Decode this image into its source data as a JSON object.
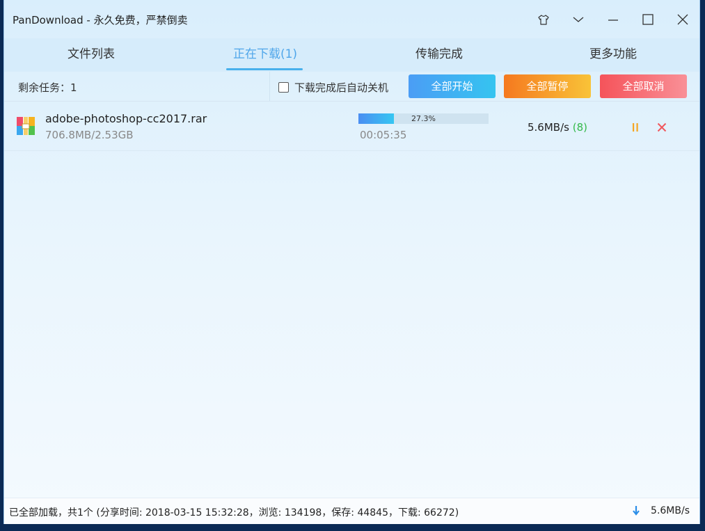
{
  "window": {
    "title": "PanDownload - 永久免费，严禁倒卖"
  },
  "titlebar_icons": [
    "shirt-icon",
    "chevron-down-icon",
    "minimize-icon",
    "maximize-icon",
    "close-icon"
  ],
  "tabs": [
    {
      "label": "文件列表"
    },
    {
      "label": "正在下载(1)",
      "active": true
    },
    {
      "label": "传输完成"
    },
    {
      "label": "更多功能"
    }
  ],
  "toolbar": {
    "remaining": "剩余任务：1",
    "auto_shutdown": {
      "label": "下载完成后自动关机",
      "checked": false
    },
    "start_all": "全部开始",
    "pause_all": "全部暂停",
    "cancel_all": "全部取消"
  },
  "downloads": [
    {
      "name": "adobe-photoshop-cc2017.rar",
      "size": "706.8MB/2.53GB",
      "progress": 0.273,
      "progress_text": "27.3%",
      "time_left": "00:05:35",
      "speed": "5.6MB/s",
      "connections": "(8)",
      "icon": "archive-icon"
    }
  ],
  "status": {
    "text": "已全部加载，共1个 (分享时间: 2018-03-15 15:32:28，浏览: 134198，保存: 44845，下载: 66272)",
    "speed": "5.6MB/s"
  },
  "colors": {
    "accent": "#48b0ec",
    "start": "#4b9df5",
    "pause": "#f5791f",
    "cancel": "#f5535a",
    "peers": "#34b94a"
  }
}
